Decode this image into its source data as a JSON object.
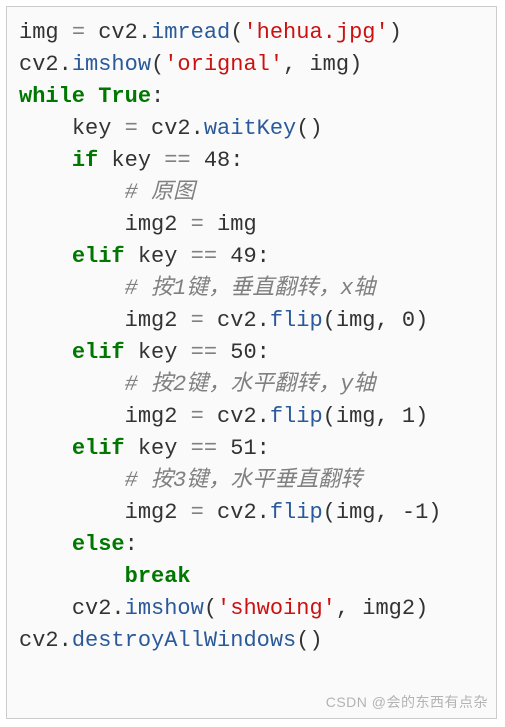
{
  "tokens": {
    "img": "img",
    "eq": "=",
    "cv2": "cv2",
    "dot": ".",
    "imread": "imread",
    "lp": "(",
    "rp": ")",
    "s_hehua": "'hehua.jpg'",
    "imshow": "imshow",
    "s_orignal": "'orignal'",
    "comma": ",",
    "while": "while",
    "True": "True",
    "colon": ":",
    "key": "key",
    "waitKey": "waitKey",
    "if": "if",
    "eqeq": "==",
    "n48": "48",
    "cmt0": "# 原图",
    "img2": "img2",
    "elif": "elif",
    "n49": "49",
    "cmt1": "# 按1键，垂直翻转，x轴",
    "flip": "flip",
    "n0": "0",
    "n50": "50",
    "cmt2": "# 按2键，水平翻转，y轴",
    "n1": "1",
    "n51": "51",
    "cmt3": "# 按3键，水平垂直翻转",
    "nm1": "-1",
    "else": "else",
    "break": "break",
    "s_shwoing": "'shwoing'",
    "destroy": "destroyAllWindows"
  },
  "watermark": "CSDN @会的东西有点杂"
}
